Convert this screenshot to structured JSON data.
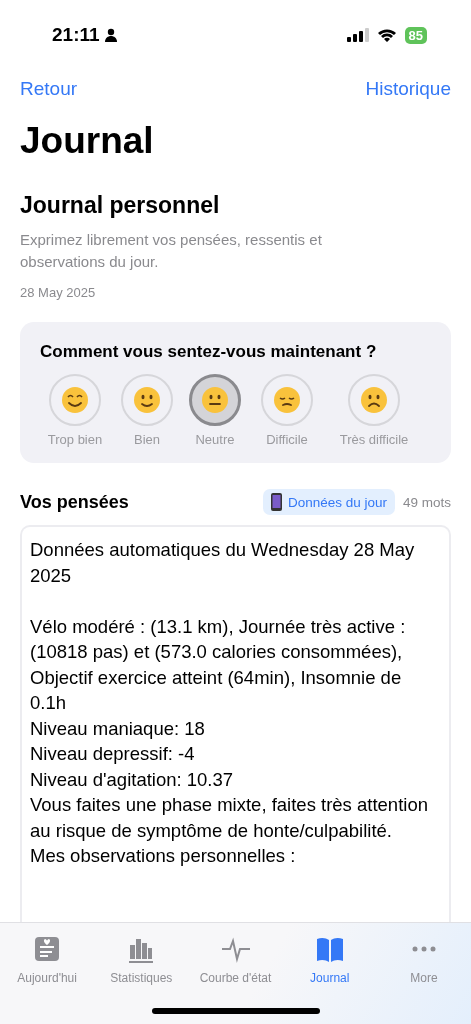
{
  "status_bar": {
    "time": "21:11",
    "battery": "85"
  },
  "nav": {
    "back": "Retour",
    "action": "Historique"
  },
  "title": "Journal",
  "section": {
    "title": "Journal personnel",
    "description": "Exprimez librement vos pensées, ressentis et observations du jour.",
    "date": "28 May 2025"
  },
  "mood": {
    "question": "Comment vous sentez-vous maintenant ?",
    "options": [
      {
        "label": "Trop bien",
        "kind": "grin",
        "selected": false
      },
      {
        "label": "Bien",
        "kind": "smile",
        "selected": false
      },
      {
        "label": "Neutre",
        "kind": "neutral",
        "selected": true
      },
      {
        "label": "Difficile",
        "kind": "pensive",
        "selected": false
      },
      {
        "label": "Très difficile",
        "kind": "sad",
        "selected": false
      }
    ]
  },
  "thoughts": {
    "title": "Vos pensées",
    "data_button": "Données du jour",
    "word_count": "49 mots",
    "text": "Données automatiques du Wednesday 28 May 2025\n\nVélo modéré : (13.1 km), Journée très active : (10818 pas) et (573.0 calories consommées), Objectif exercice atteint (64min), Insomnie de 0.1h\nNiveau maniaque: 18\nNiveau depressif: -4\nNiveau d'agitation: 10.37\nVous faites une phase mixte, faites très attention au risque de symptôme de honte/culpabilité.\nMes observations personnelles :"
  },
  "tab_bar": [
    {
      "label": "Aujourd'hui",
      "kind": "today",
      "selected": false
    },
    {
      "label": "Statistiques",
      "kind": "stats",
      "selected": false
    },
    {
      "label": "Courbe d'état",
      "kind": "pulse",
      "selected": false
    },
    {
      "label": "Journal",
      "kind": "book",
      "selected": true
    },
    {
      "label": "More",
      "kind": "more",
      "selected": false
    }
  ]
}
